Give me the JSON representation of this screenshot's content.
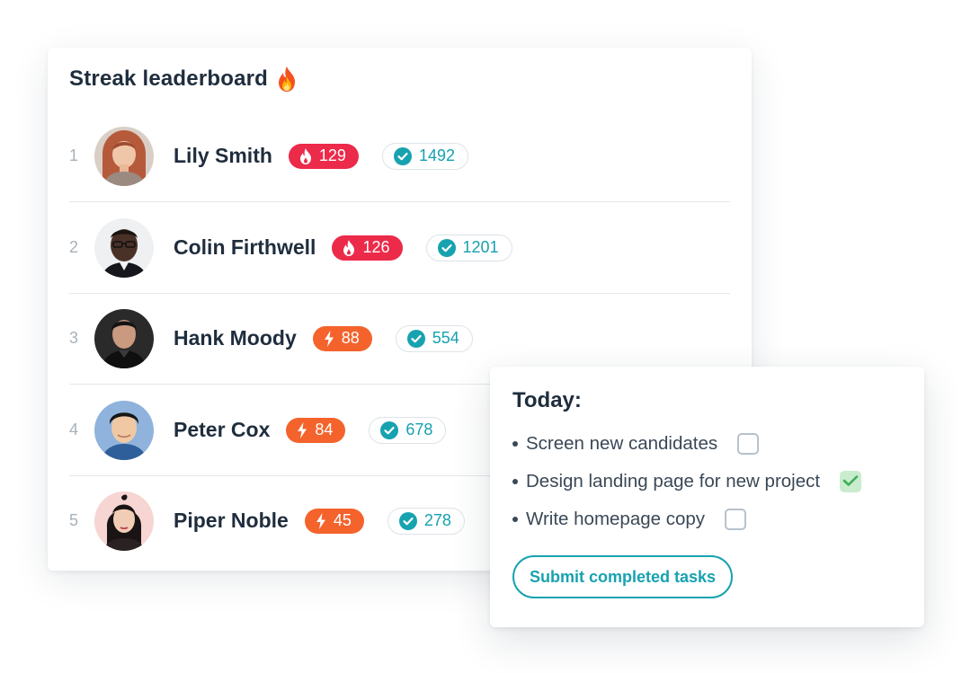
{
  "leaderboard": {
    "title": "Streak leaderboard",
    "title_icon": "fire-emoji-icon",
    "rows": [
      {
        "rank": "1",
        "name": "Lily Smith",
        "streak": "129",
        "streak_icon": "flame-icon",
        "streak_color": "#ec2a4a",
        "completed": "1492",
        "completed_icon": "check-circle-icon"
      },
      {
        "rank": "2",
        "name": "Colin Firthwell",
        "streak": "126",
        "streak_icon": "flame-icon",
        "streak_color": "#ec2a4a",
        "completed": "1201",
        "completed_icon": "check-circle-icon"
      },
      {
        "rank": "3",
        "name": "Hank Moody",
        "streak": "88",
        "streak_icon": "lightning-icon",
        "streak_color": "#f4632c",
        "completed": "554",
        "completed_icon": "check-circle-icon"
      },
      {
        "rank": "4",
        "name": "Peter Cox",
        "streak": "84",
        "streak_icon": "lightning-icon",
        "streak_color": "#f4632c",
        "completed": "678",
        "completed_icon": "check-circle-icon"
      },
      {
        "rank": "5",
        "name": "Piper Noble",
        "streak": "45",
        "streak_icon": "lightning-icon",
        "streak_color": "#f4632c",
        "completed": "278",
        "completed_icon": "check-circle-icon"
      }
    ]
  },
  "today": {
    "title": "Today:",
    "tasks": [
      {
        "label": "Screen new candidates",
        "checked": false
      },
      {
        "label": "Design landing page for new project",
        "checked": true
      },
      {
        "label": "Write homepage copy",
        "checked": false
      }
    ],
    "submit_label": "Submit completed tasks"
  },
  "colors": {
    "accent_teal": "#17a2b0",
    "streak_hot": "#ec2a4a",
    "streak_warm": "#f4632c",
    "check_green_bg": "#c9ecce",
    "check_green": "#3fae55"
  }
}
